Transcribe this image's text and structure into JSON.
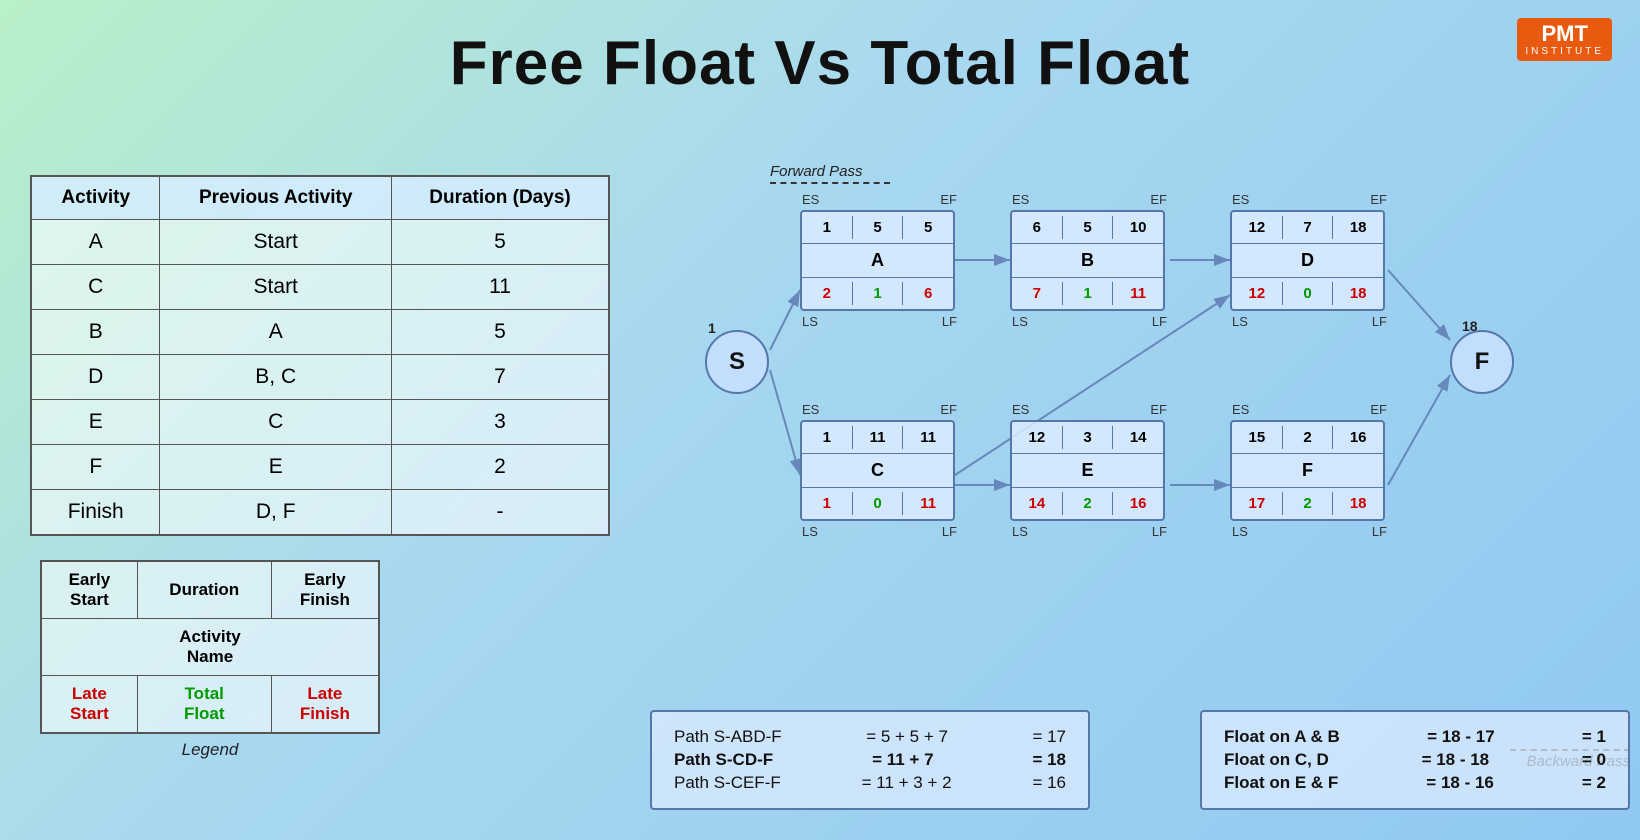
{
  "title": "Free Float Vs Total Float",
  "logo": {
    "brand": "PMT",
    "subtitle": "INSTITUTE"
  },
  "table": {
    "headers": [
      "Activity",
      "Previous Activity",
      "Duration (Days)"
    ],
    "rows": [
      [
        "A",
        "Start",
        "5"
      ],
      [
        "C",
        "Start",
        "11"
      ],
      [
        "B",
        "A",
        "5"
      ],
      [
        "D",
        "B, C",
        "7"
      ],
      [
        "E",
        "C",
        "3"
      ],
      [
        "F",
        "E",
        "2"
      ],
      [
        "Finish",
        "D, F",
        "-"
      ]
    ]
  },
  "legend": {
    "row1": [
      "Early Start",
      "Duration",
      "Early Finish"
    ],
    "row2": [
      "Activity Name"
    ],
    "row3_labels": [
      "Late Start",
      "Total Float",
      "Late Finish"
    ],
    "label": "Legend"
  },
  "nodes": {
    "start": {
      "label": "S",
      "value": "1"
    },
    "finish": {
      "label": "F",
      "value": "18"
    },
    "A": {
      "es": "1",
      "dur": "5",
      "ef": "5",
      "name": "A",
      "ls": "2",
      "tf": "1",
      "lf": "6"
    },
    "B": {
      "es": "6",
      "dur": "5",
      "ef": "10",
      "name": "B",
      "ls": "7",
      "tf": "1",
      "lf": "11"
    },
    "D": {
      "es": "12",
      "dur": "7",
      "ef": "18",
      "name": "D",
      "ls": "12",
      "tf": "0",
      "lf": "18"
    },
    "C": {
      "es": "1",
      "dur": "11",
      "ef": "11",
      "name": "C",
      "ls": "1",
      "tf": "0",
      "lf": "11"
    },
    "E": {
      "es": "12",
      "dur": "3",
      "ef": "14",
      "name": "E",
      "ls": "14",
      "tf": "2",
      "lf": "16"
    },
    "F_node": {
      "es": "15",
      "dur": "2",
      "ef": "16",
      "name": "F",
      "ls": "17",
      "tf": "2",
      "lf": "18"
    }
  },
  "labels": {
    "forward_pass": "Forward Pass",
    "backward_pass": "Backward Pass",
    "es": "ES",
    "ef": "EF",
    "ls": "LS",
    "lf": "LF"
  },
  "paths": {
    "rows": [
      {
        "label": "Path S-ABD-F",
        "eq": "= 5 + 5 + 7",
        "result": "= 17",
        "bold": false
      },
      {
        "label": "Path S-CD-F",
        "eq": "= 11 + 7",
        "result": "= 18",
        "bold": true
      },
      {
        "label": "Path S-CEF-F",
        "eq": "= 11 + 3 + 2",
        "result": "= 16",
        "bold": false
      }
    ]
  },
  "floats": {
    "rows": [
      {
        "label": "Float on A & B",
        "eq": "= 18 - 17",
        "result": "= 1"
      },
      {
        "label": "Float on C, D",
        "eq": "= 18 - 18",
        "result": "= 0"
      },
      {
        "label": "Float on E & F",
        "eq": "= 18 - 16",
        "result": "= 2"
      }
    ]
  }
}
